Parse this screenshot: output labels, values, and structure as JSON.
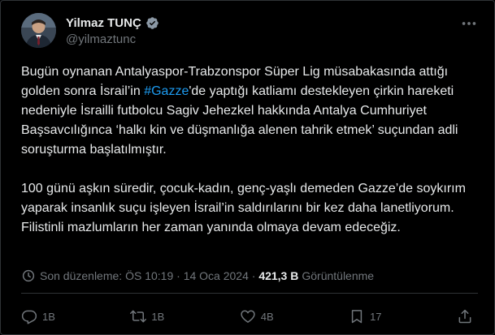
{
  "author": {
    "name": "Yilmaz TUNÇ",
    "handle": "@yilmaztunc"
  },
  "tweet": {
    "paragraph1_before": "Bugün oynanan Antalyaspor-Trabzonspor Süper Lig müsabakasında attığı golden sonra İsrail’in ",
    "hashtag": "#Gazze",
    "paragraph1_after": "'de yaptığı katliamı destekleyen çirkin hareketi nedeniyle İsrailli futbolcu Sagiv Jehezkel hakkında Antalya Cumhuriyet Başsavcılığınca ‘halkı kin ve düşmanlığa alenen tahrik etmek’ suçundan adli soruşturma başlatılmıştır.",
    "paragraph2": "100 günü aşkın süredir, çocuk-kadın, genç-yaşlı demeden Gazze’de soykırım yaparak insanlık suçu işleyen İsrail’in saldırılarını bir kez daha lanetliyorum. Filistinli mazlumların her zaman yanında olmaya devam edeceğiz."
  },
  "meta": {
    "edited": "Son düzenleme:",
    "time": "ÖS 10:19",
    "separator": "·",
    "date": "14 Oca 2024",
    "views_count": "421,3 B",
    "views_label": "Görüntülenme"
  },
  "actions": {
    "replies": "1B",
    "reposts": "1B",
    "likes": "4B",
    "bookmarks": "17"
  },
  "colors": {
    "background": "#000000",
    "text": "#e7e9ea",
    "muted": "#71767b",
    "accent": "#1d9bf0"
  },
  "icons": [
    "verified-badge-icon",
    "more-icon",
    "clock-icon",
    "reply-icon",
    "repost-icon",
    "like-icon",
    "bookmark-icon",
    "share-icon"
  ]
}
